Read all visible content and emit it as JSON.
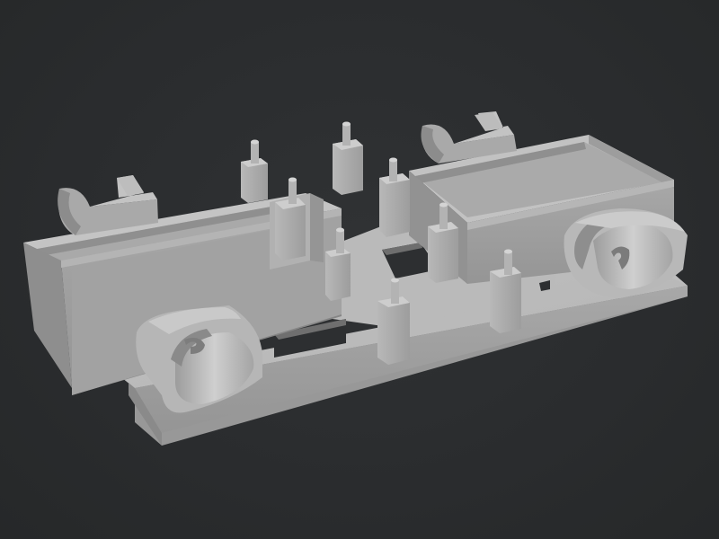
{
  "viewport": {
    "background": "#2b2d2f"
  },
  "model": {
    "material": {
      "top": "#b9b9b9",
      "front": "#9a9a9a",
      "side": "#8c8c8c",
      "dark": "#7c7c7c",
      "light": "#c6c6c6",
      "edge": "#a6a6a6"
    },
    "parts": [
      "base-plate",
      "left-tray",
      "right-tray",
      "cable-clip-front-left",
      "cable-clip-front-right",
      "cable-clip-back-left",
      "cable-clip-back-right",
      "standoff-posts",
      "plate-cutouts"
    ]
  }
}
